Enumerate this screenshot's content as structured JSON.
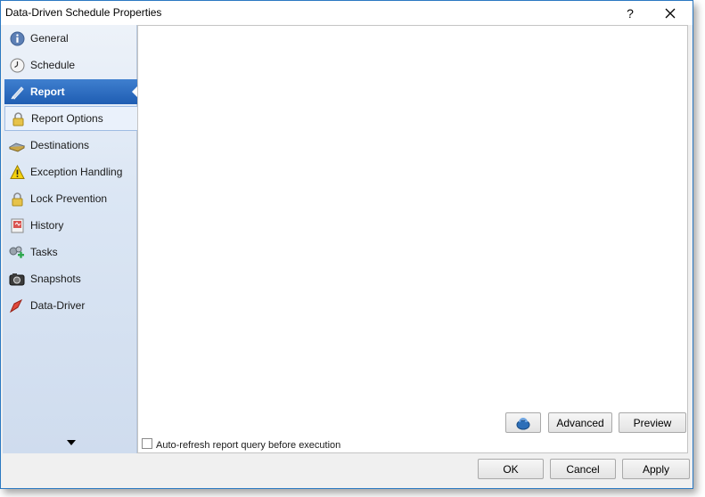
{
  "window": {
    "title": "Data-Driven Schedule Properties",
    "help_label": "?",
    "close_label": "✕"
  },
  "sidebar": {
    "items": [
      {
        "label": "General",
        "icon": "info-icon"
      },
      {
        "label": "Schedule",
        "icon": "clock-icon"
      },
      {
        "label": "Report",
        "icon": "report-pen-icon",
        "active": true
      },
      {
        "label": "Report Options",
        "icon": "lock-icon",
        "sub": true
      },
      {
        "label": "Destinations",
        "icon": "destinations-icon"
      },
      {
        "label": "Exception Handling",
        "icon": "warning-icon"
      },
      {
        "label": "Lock Prevention",
        "icon": "lock-icon"
      },
      {
        "label": "History",
        "icon": "history-icon"
      },
      {
        "label": "Tasks",
        "icon": "tasks-icon"
      },
      {
        "label": "Snapshots",
        "icon": "camera-icon"
      },
      {
        "label": "Data-Driver",
        "icon": "data-driver-icon"
      }
    ]
  },
  "main": {
    "advanced_label": "Advanced",
    "preview_label": "Preview",
    "auto_refresh_label": "Auto-refresh report query before execution",
    "auto_refresh_checked": false
  },
  "footer": {
    "ok_label": "OK",
    "cancel_label": "Cancel",
    "apply_label": "Apply"
  },
  "colors": {
    "accent": "#2b79c2",
    "active_item": "#2a6bc0"
  }
}
